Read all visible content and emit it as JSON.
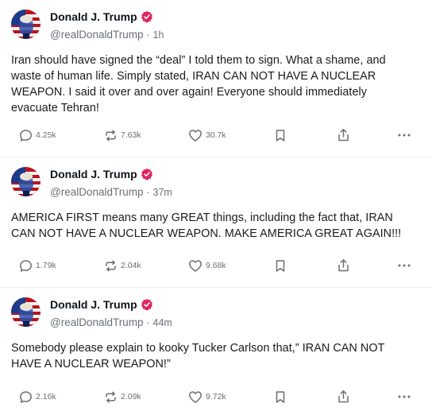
{
  "posts": [
    {
      "author": "Donald J. Trump",
      "handle": "@realDonaldTrump",
      "sep": " · ",
      "time": "1h",
      "text": "Iran should have signed the “deal” I told them to sign. What a shame, and waste of human life. Simply stated, IRAN CAN NOT HAVE A NUCLEAR WEAPON. I said it over and over again! Everyone should immediately evacuate Tehran!",
      "replies": "4.25k",
      "reposts": "7.63k",
      "likes": "30.7k"
    },
    {
      "author": "Donald J. Trump",
      "handle": "@realDonaldTrump",
      "sep": " · ",
      "time": "37m",
      "text": "AMERICA FIRST means many GREAT things, including the fact that, IRAN CAN NOT HAVE A NUCLEAR WEAPON. MAKE AMERICA GREAT AGAIN!!!",
      "replies": "1.79k",
      "reposts": "2.04k",
      "likes": "9.68k"
    },
    {
      "author": "Donald J. Trump",
      "handle": "@realDonaldTrump",
      "sep": " · ",
      "time": "44m",
      "text": "Somebody please explain to kooky Tucker Carlson that,” IRAN CAN NOT HAVE A NUCLEAR WEAPON!”",
      "replies": "2.16k",
      "reposts": "2.09k",
      "likes": "9.72k"
    }
  ],
  "colors": {
    "verified": "#e0245e",
    "muted": "#6b6f74",
    "text": "#1a1a1a"
  },
  "icons": [
    "speech-bubble-icon",
    "repost-arrows-icon",
    "heart-icon",
    "bookmark-icon",
    "share-upload-icon",
    "more-dots-icon",
    "verified-badge-icon"
  ]
}
